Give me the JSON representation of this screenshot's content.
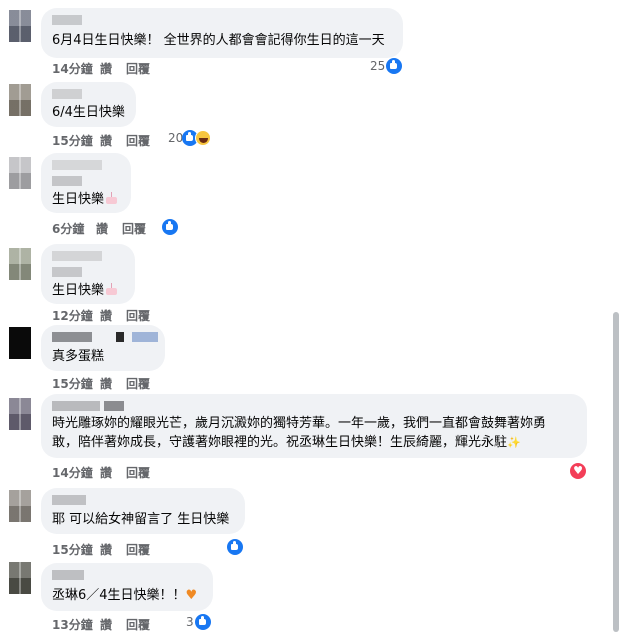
{
  "ui": {
    "like_label": "讚",
    "reply_label": "回覆",
    "like_icon": "like-icon",
    "love_icon": "love-icon",
    "haha_icon": "haha-icon",
    "colors": {
      "bubble": "#f0f2f5",
      "meta": "#65676b",
      "like": "#1877f2",
      "love": "#f33e58",
      "scrollbar": "#bcc0c4"
    }
  },
  "comments": [
    {
      "text": "6月4日生日快樂！ 全世界的人都會會記得你生日的這一天",
      "time": "14分鐘",
      "reaction_count": "25",
      "reactions": [
        "like"
      ]
    },
    {
      "text": "6/4生日快樂",
      "time": "15分鐘",
      "reaction_count": "20",
      "reactions": [
        "like",
        "haha"
      ]
    },
    {
      "text": "生日快樂",
      "emoji": "birthday-cake",
      "time": "6分鐘",
      "reaction_count": "",
      "reactions": [
        "like"
      ]
    },
    {
      "text": "生日快樂",
      "emoji": "birthday-cake",
      "time": "12分鐘",
      "reaction_count": "",
      "reactions": []
    },
    {
      "text": "真多蛋糕",
      "time": "15分鐘",
      "reaction_count": "",
      "reactions": []
    },
    {
      "text_lines": [
        "時光雕琢妳的耀眼光芒，歲月沉澱妳的獨特芳華。一年一歲，我們一直都會鼓舞著妳勇",
        "敢，陪伴著妳成長，守護著妳眼裡的光。祝丞琳生日快樂！生辰綺麗，輝光永駐"
      ],
      "emoji": "sparkles",
      "time": "14分鐘",
      "reaction_count": "",
      "reactions": [
        "love"
      ]
    },
    {
      "text": "耶 可以給女神留言了 生日快樂",
      "time": "15分鐘",
      "reaction_count": "",
      "reactions": [
        "like"
      ]
    },
    {
      "text": "丞琳6／4生日快樂！！",
      "emoji": "orange-heart",
      "time": "13分鐘",
      "reaction_count": "3",
      "reactions": [
        "like"
      ]
    }
  ]
}
